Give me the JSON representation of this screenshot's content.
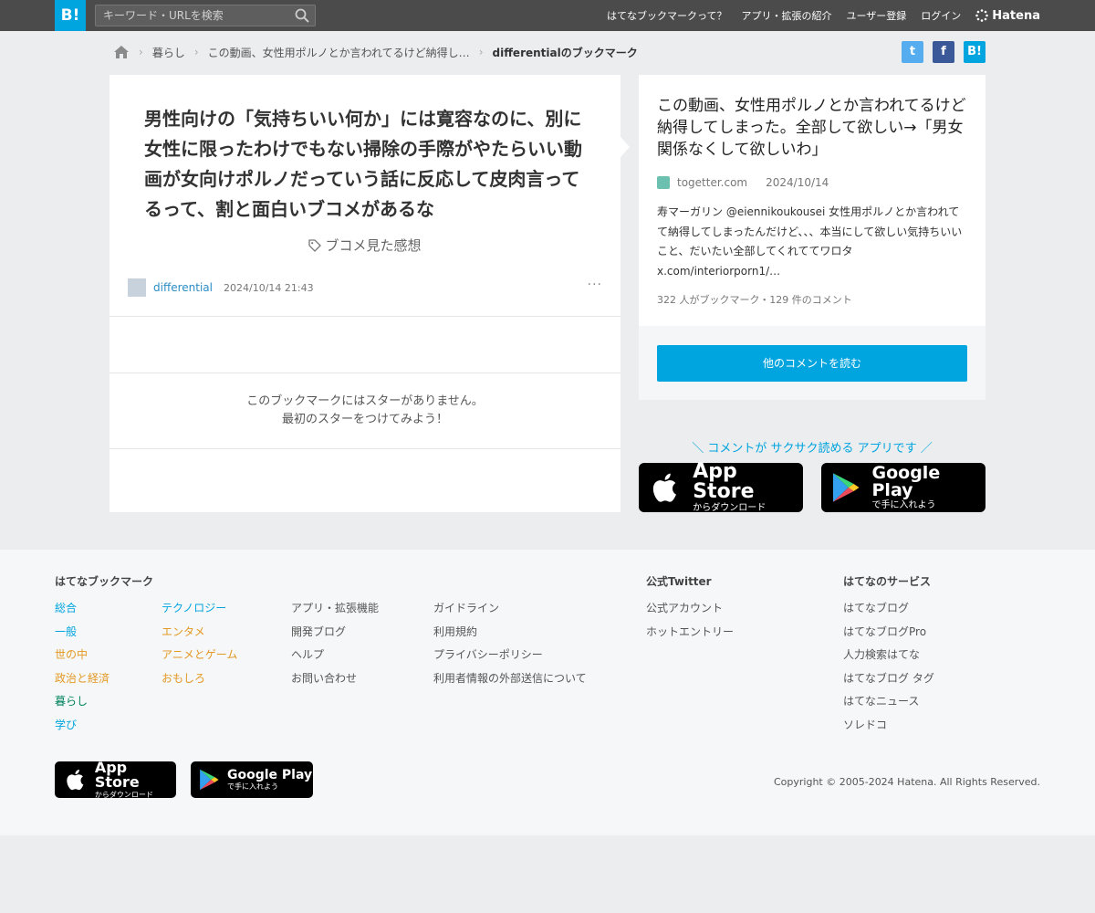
{
  "header": {
    "logo": "B!",
    "search_placeholder": "キーワード・URLを検索",
    "nav": [
      "はてなブックマークって？",
      "アプリ・拡張の紹介",
      "ユーザー登録",
      "ログイン"
    ],
    "brand": "Hatena"
  },
  "breadcrumb": {
    "items": [
      "暮らし",
      "この動画、女性用ポルノとか言われてるけど納得し…",
      "differentialのブックマーク"
    ]
  },
  "share": {
    "twitter": "t",
    "facebook": "f",
    "hatena": "B!"
  },
  "bookmark": {
    "comment": "男性向けの「気持ちいい何か」には寛容なのに、別に女性に限ったわけでもない掃除の手際がやたらいい動画が女向けポルノだっていう話に反応して皮肉言ってるって、割と面白いブコメがあるな",
    "tag": "ブコメ見た感想",
    "username": "differential",
    "datetime": "2024/10/14 21:43",
    "more": "···",
    "no_star_line1": "このブックマークにはスターがありません。",
    "no_star_line2": "最初のスターをつけてみよう！"
  },
  "entry": {
    "title": "この動画、女性用ポルノとか言われてるけど納得してしまった。全部して欲しい→「男女関係なくして欲しいわ」",
    "domain": "togetter.com",
    "date": "2024/10/14",
    "excerpt": "寿マーガリン @eiennikoukousei 女性用ポルノとか言われてて納得してしまったんだけど、、、本当にして欲しい気持ちいいこと、だいたい全部してくれててワロタ x.com/interiorporn1/…",
    "stats": "322 人がブックマーク・129 件のコメント",
    "read_comments": "他のコメントを読む"
  },
  "app_promo": {
    "text": "＼ コメントが サクサク読める アプリです ／",
    "appstore_title": "App Store",
    "appstore_sub": "からダウンロード",
    "googleplay_title": "Google Play",
    "googleplay_sub": "で手に入れよう"
  },
  "footer": {
    "hatebu_title": "はてなブックマーク",
    "col1": [
      "総合",
      "一般",
      "世の中",
      "政治と経済",
      "暮らし",
      "学び"
    ],
    "col2": [
      "テクノロジー",
      "エンタメ",
      "アニメとゲーム",
      "おもしろ"
    ],
    "col3": [
      "アプリ・拡張機能",
      "開発ブログ",
      "ヘルプ",
      "お問い合わせ"
    ],
    "col4": [
      "ガイドライン",
      "利用規約",
      "プライバシーポリシー",
      "利用者情報の外部送信について"
    ],
    "twitter_title": "公式Twitter",
    "twitter_links": [
      "公式アカウント",
      "ホットエントリー"
    ],
    "services_title": "はてなのサービス",
    "services": [
      "はてなブログ",
      "はてなブログPro",
      "人力検索はてな",
      "はてなブログ タグ",
      "はてなニュース",
      "ソレドコ"
    ],
    "copyright": "Copyright © 2005-2024 Hatena. All Rights Reserved."
  },
  "colors": {
    "accent": "#00a4de",
    "header": "#4b4b4b",
    "orange": "#e39925",
    "green": "#00835d"
  }
}
